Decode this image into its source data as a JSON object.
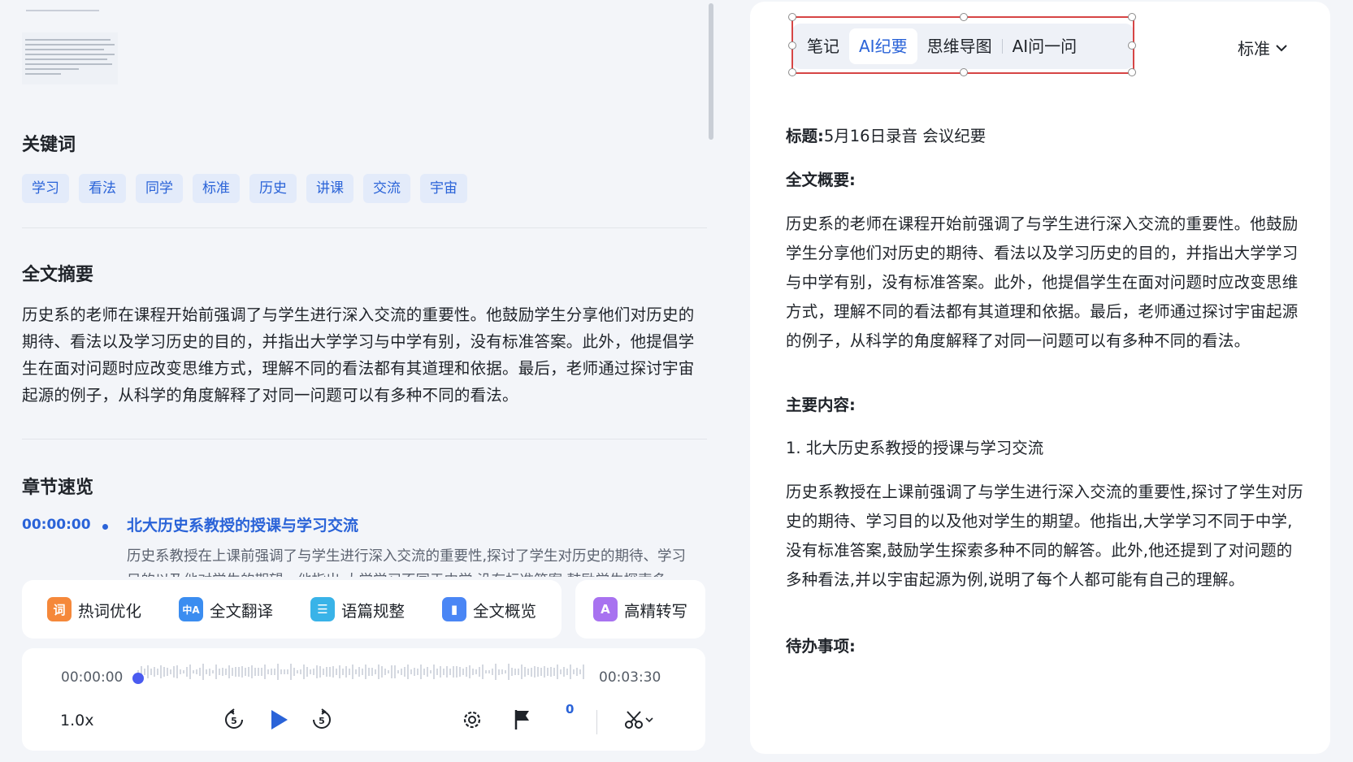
{
  "left": {
    "keywords_title": "关键词",
    "keywords": [
      "学习",
      "看法",
      "同学",
      "标准",
      "历史",
      "讲课",
      "交流",
      "宇宙"
    ],
    "summary_title": "全文摘要",
    "summary_text": "历史系的老师在课程开始前强调了与学生进行深入交流的重要性。他鼓励学生分享他们对历史的期待、看法以及学习历史的目的，并指出大学学习与中学有别，没有标准答案。此外，他提倡学生在面对问题时应改变思维方式，理解不同的看法都有其道理和依据。最后，老师通过探讨宇宙起源的例子，从科学的角度解释了对同一问题可以有多种不同的看法。",
    "chapters_title": "章节速览",
    "chapter": {
      "time": "00:00:00",
      "title": "北大历史系教授的授课与学习交流",
      "desc": "历史系教授在上课前强调了与学生进行深入交流的重要性,探讨了学生对历史的期待、学习目的以及他对学生的期望。他指出,大学学习不同于中学,没有标准答案,鼓励学生探索多"
    }
  },
  "tools": [
    {
      "label": "热词优化",
      "icon": "hotword-icon",
      "glyph": "词",
      "color": "#f5883a"
    },
    {
      "label": "全文翻译",
      "icon": "translate-icon",
      "glyph": "中A",
      "color": "#3b8df0"
    },
    {
      "label": "语篇规整",
      "icon": "tidy-icon",
      "glyph": "☰",
      "color": "#39b3e8"
    },
    {
      "label": "全文概览",
      "icon": "overview-icon",
      "glyph": "▮",
      "color": "#4a86f5"
    },
    {
      "label": "高精转写",
      "icon": "hq-transcribe-icon",
      "glyph": "A",
      "color": "#a872f0"
    }
  ],
  "player": {
    "current_time": "00:00:00",
    "total_time": "00:03:30",
    "speed": "1.0x",
    "flag_count": "0",
    "progress": 0
  },
  "right": {
    "tabs": [
      "笔记",
      "AI纪要",
      "思维导图",
      "AI问一问"
    ],
    "active_tab": 1,
    "mode": "标准",
    "title_label": "标题:",
    "title_value": "5月16日录音 会议纪要",
    "overview_label": "全文概要:",
    "overview_text": "历史系的老师在课程开始前强调了与学生进行深入交流的重要性。他鼓励学生分享他们对历史的期待、看法以及学习历史的目的，并指出大学学习与中学有别，没有标准答案。此外，他提倡学生在面对问题时应改变思维方式，理解不同的看法都有其道理和依据。最后，老师通过探讨宇宙起源的例子，从科学的角度解释了对同一问题可以有多种不同的看法。",
    "main_label": "主要内容:",
    "main_item": "1. 北大历史系教授的授课与学习交流",
    "main_text": "历史系教授在上课前强调了与学生进行深入交流的重要性,探讨了学生对历史的期待、学习目的以及他对学生的期望。他指出,大学学习不同于中学,没有标准答案,鼓励学生探索多种不同的解答。此外,他还提到了对问题的多种看法,并以宇宙起源为例,说明了每个人都可能有自己的理解。",
    "todo_label": "待办事项:"
  },
  "colors": {
    "accent": "#2a63d8",
    "keyword_bg": "#e3ebfa",
    "selection": "#d64545"
  }
}
